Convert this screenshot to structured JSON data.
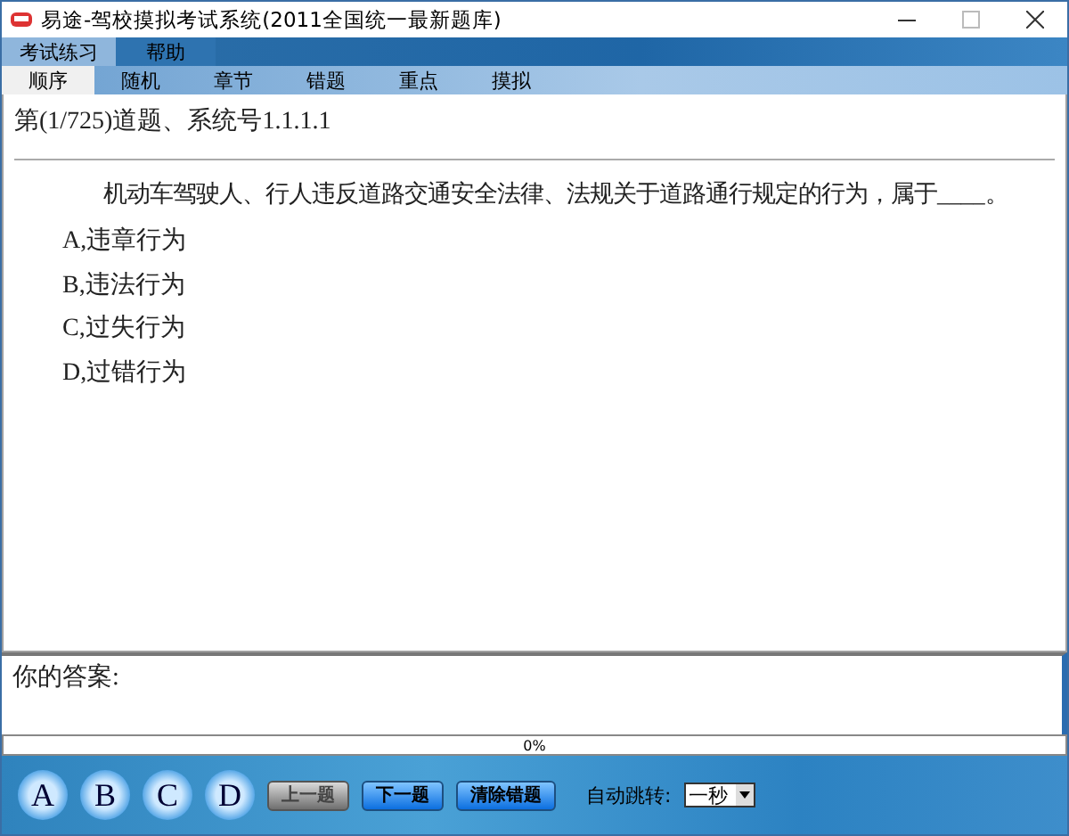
{
  "window": {
    "title": "易途-驾校摸拟考试系统(2011全国统一最新题库)"
  },
  "menu": [
    {
      "label": "考试练习",
      "selected": true
    },
    {
      "label": "帮助",
      "selected": false
    }
  ],
  "tabs": [
    {
      "label": "顺序",
      "selected": true
    },
    {
      "label": "随机",
      "selected": false
    },
    {
      "label": "章节",
      "selected": false
    },
    {
      "label": "错题",
      "selected": false
    },
    {
      "label": "重点",
      "selected": false
    },
    {
      "label": "摸拟",
      "selected": false
    }
  ],
  "question": {
    "header": "第(1/725)道题、系统号1.1.1.1",
    "text": "机动车驾驶人、行人违反道路交通安全法律、法规关于道路通行规定的行为，属于____。",
    "options": [
      "A,违章行为",
      "B,违法行为",
      "C,过失行为",
      "D,过错行为"
    ]
  },
  "answer": {
    "label": "你的答案:"
  },
  "progress": {
    "level": 0,
    "reading": "0%"
  },
  "answer_buttons": [
    "A",
    "B",
    "C",
    "D"
  ],
  "nav_buttons": [
    {
      "label": "上一题",
      "disabled": true
    },
    {
      "label": "下一题",
      "disabled": false
    },
    {
      "label": "清除错题",
      "disabled": false
    }
  ],
  "auto_jump": {
    "label": "自动跳转:",
    "value": "一秒"
  }
}
